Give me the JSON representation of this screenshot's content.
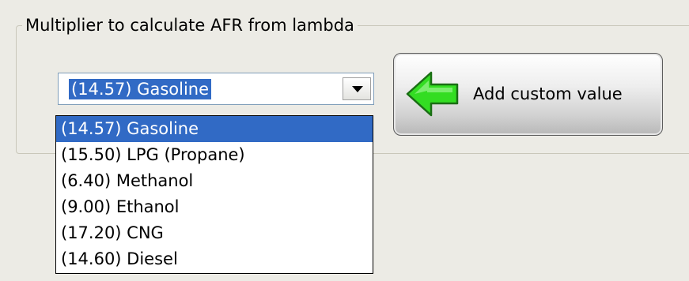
{
  "group": {
    "title": "Multiplier to calculate AFR from lambda"
  },
  "combo": {
    "selected_value": "(14.57) Gasoline",
    "arrow_icon": "chevron-down-icon"
  },
  "dropdown": {
    "options": [
      "(14.57) Gasoline",
      "(15.50) LPG (Propane)",
      "(6.40) Methanol",
      "(9.00) Ethanol",
      "(17.20) CNG",
      "(14.60) Diesel"
    ],
    "highlighted_index": 0
  },
  "add_button": {
    "label": "Add custom value",
    "icon": "arrow-left-icon",
    "icon_color": "#33dd22"
  },
  "colors": {
    "selection": "#316ac5",
    "background": "#ecebe5"
  }
}
